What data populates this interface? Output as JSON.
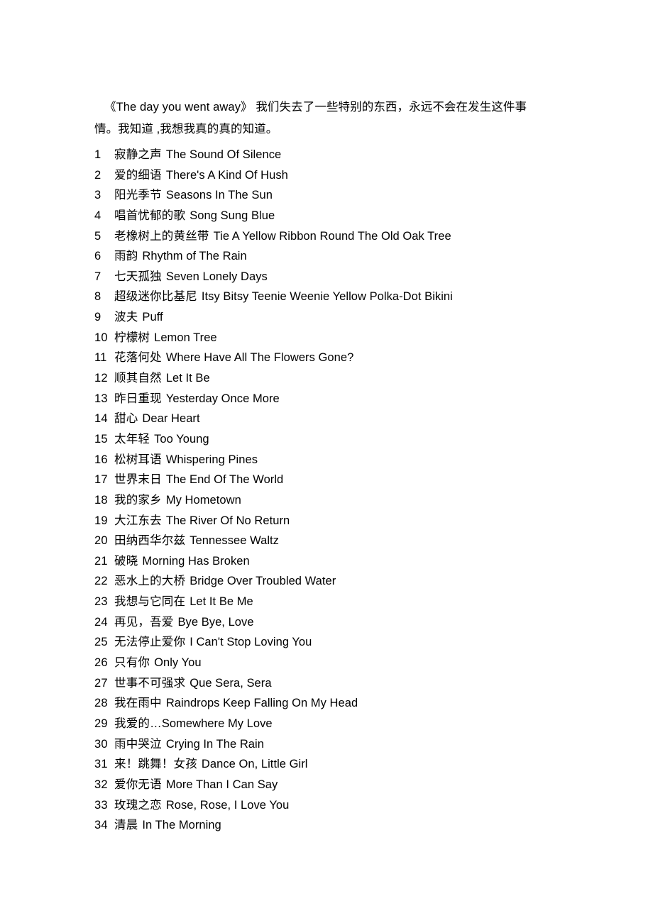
{
  "document": {
    "intro": "《The day you went away》 我们失去了一些特别的东西，永远不会在发生这件事情。我知道 ,我想我真的真的知道。",
    "text_color": "#000000",
    "background_color": "#ffffff"
  },
  "songs": [
    {
      "index": "1",
      "cn": "寂静之声",
      "en": "The Sound Of Silence"
    },
    {
      "index": "2",
      "cn": "爱的细语",
      "en": "There's A Kind Of Hush"
    },
    {
      "index": "3",
      "cn": "阳光季节",
      "en": "Seasons In The Sun"
    },
    {
      "index": "4",
      "cn": "唱首忧郁的歌",
      "en": "Song Sung Blue"
    },
    {
      "index": "5",
      "cn": "老橡树上的黄丝带",
      "en": "Tie A Yellow Ribbon Round The Old Oak Tree"
    },
    {
      "index": "6",
      "cn": "雨韵",
      "en": "Rhythm of The Rain"
    },
    {
      "index": "7",
      "cn": "七天孤独",
      "en": "Seven Lonely Days"
    },
    {
      "index": "8",
      "cn": "超级迷你比基尼",
      "en": "Itsy Bitsy Teenie Weenie Yellow Polka-Dot Bikini"
    },
    {
      "index": "9",
      "cn": "波夫",
      "en": "Puff"
    },
    {
      "index": "10",
      "cn": "柠檬树",
      "en": "Lemon Tree"
    },
    {
      "index": "11",
      "cn": "花落何处",
      "en": "Where Have All The Flowers Gone?"
    },
    {
      "index": "12",
      "cn": "顺其自然",
      "en": "Let It Be"
    },
    {
      "index": "13",
      "cn": "昨日重现",
      "en": "Yesterday Once More"
    },
    {
      "index": "14",
      "cn": "甜心",
      "en": "Dear Heart"
    },
    {
      "index": "15",
      "cn": "太年轻",
      "en": "Too Young"
    },
    {
      "index": "16",
      "cn": "松树耳语",
      "en": "Whispering Pines"
    },
    {
      "index": "17",
      "cn": "世界末日",
      "en": "The End Of The World"
    },
    {
      "index": "18",
      "cn": "我的家乡",
      "en": "My Hometown"
    },
    {
      "index": "19",
      "cn": "大江东去",
      "en": "The River Of No Return"
    },
    {
      "index": "20",
      "cn": "田纳西华尔兹",
      "en": "Tennessee Waltz"
    },
    {
      "index": "21",
      "cn": "破晓",
      "en": "Morning Has Broken"
    },
    {
      "index": "22",
      "cn": "恶水上的大桥",
      "en": "Bridge Over Troubled Water"
    },
    {
      "index": "23",
      "cn": "我想与它同在",
      "en": "Let It Be Me"
    },
    {
      "index": "24",
      "cn": "再见，吾爱",
      "en": "Bye Bye, Love"
    },
    {
      "index": "25",
      "cn": "无法停止爱你",
      "en": "I Can't Stop Loving You"
    },
    {
      "index": "26",
      "cn": "只有你",
      "en": "Only You"
    },
    {
      "index": "27",
      "cn": "世事不可强求",
      "en": "Que Sera, Sera"
    },
    {
      "index": "28",
      "cn": "我在雨中",
      "en": "Raindrops Keep Falling On My Head"
    },
    {
      "index": "29",
      "cn": "我爱的…",
      "en": "Somewhere My Love"
    },
    {
      "index": "30",
      "cn": "雨中哭泣",
      "en": "Crying In The Rain"
    },
    {
      "index": "31",
      "cn": "来！跳舞！女孩",
      "en": "Dance On, Little Girl"
    },
    {
      "index": "32",
      "cn": "爱你无语",
      "en": "More Than I Can Say"
    },
    {
      "index": "33",
      "cn": "玫瑰之恋",
      "en": "Rose, Rose, I Love You"
    },
    {
      "index": "34",
      "cn": "清晨",
      "en": "In The Morning"
    }
  ]
}
